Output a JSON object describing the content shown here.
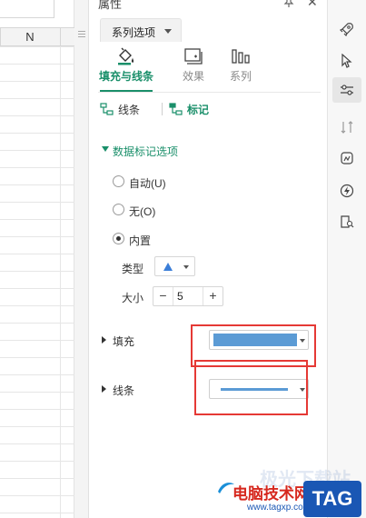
{
  "sheet": {
    "column_header": "N"
  },
  "panel": {
    "title": "属性",
    "series_dropdown": "系列选项",
    "tabs": [
      {
        "label": "填充与线条",
        "active": true
      },
      {
        "label": "效果",
        "active": false
      },
      {
        "label": "系列",
        "active": false
      }
    ],
    "subtabs": [
      {
        "label": "线条",
        "active": false
      },
      {
        "label": "标记",
        "active": true
      }
    ],
    "marker_section": {
      "title": "数据标记选项",
      "options": [
        {
          "label": "自动(U)",
          "checked": false
        },
        {
          "label": "无(O)",
          "checked": false
        },
        {
          "label": "内置",
          "checked": true
        }
      ],
      "type_label": "类型",
      "type_value": "triangle",
      "size_label": "大小",
      "size_value": "5"
    },
    "fill": {
      "label": "填充",
      "color": "#5b9bd5"
    },
    "line": {
      "label": "线条",
      "color": "#5b9bd5"
    }
  },
  "colors": {
    "accent": "#1a8f6a",
    "highlight_box": "#e53935"
  },
  "icon_bar": [
    "rocket-icon",
    "cursor-icon",
    "sliders-icon",
    "swap-icon",
    "shape-edit-icon",
    "bolt-icon",
    "book-search-icon"
  ],
  "watermark": {
    "ghost_text": "极光下载站",
    "site_text": "电脑技术网",
    "url_text": "www.tagxp.com",
    "badge": "TAG"
  }
}
